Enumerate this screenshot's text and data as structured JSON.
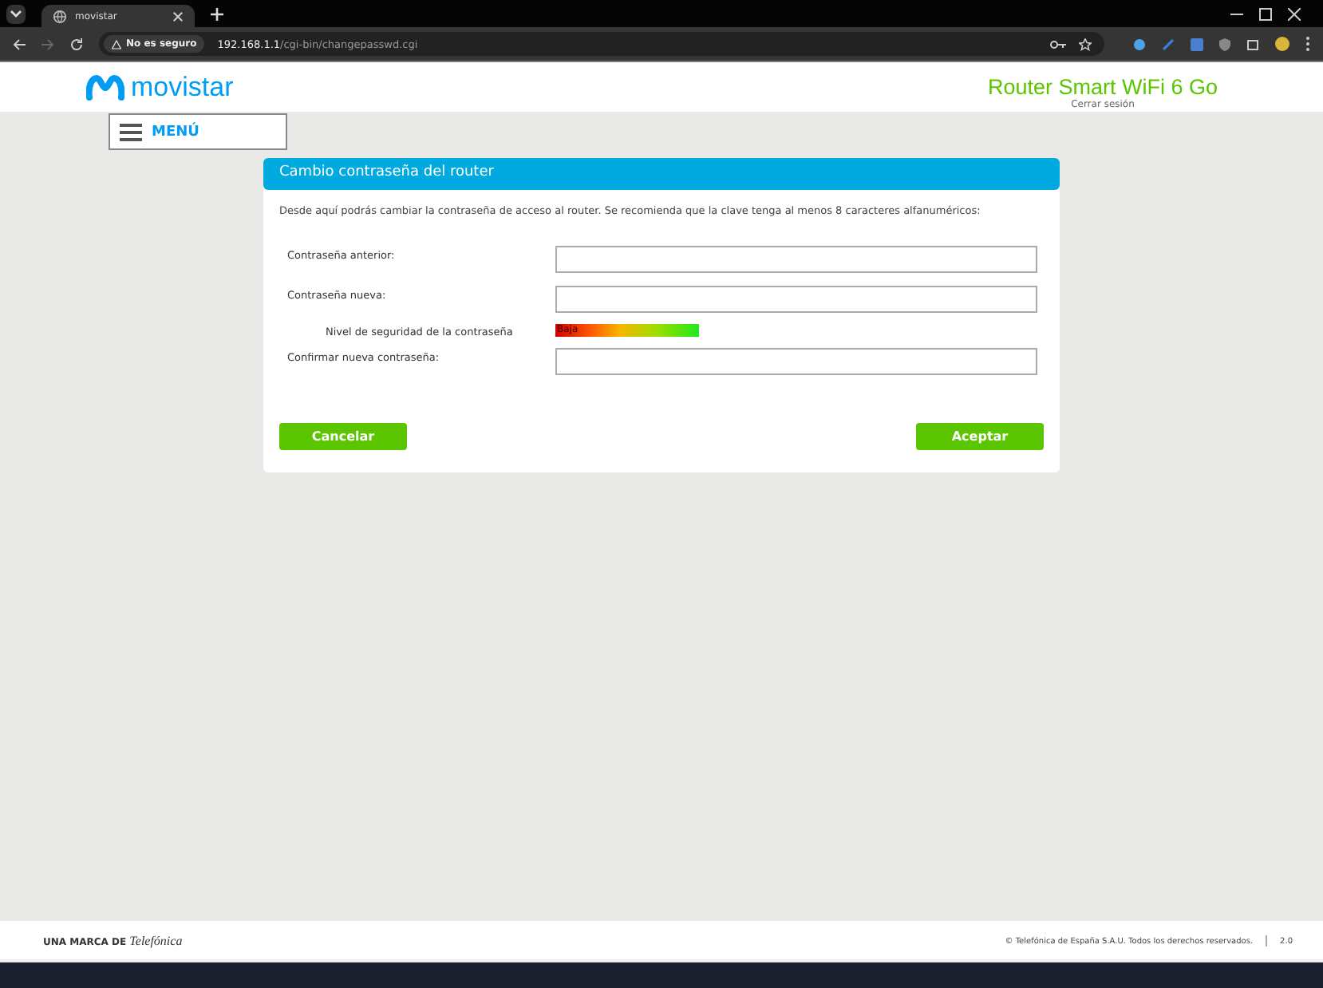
{
  "browser": {
    "tab_title": "movistar",
    "security": "No es seguro",
    "url_host": "192.168.1.1",
    "url_path": "/cgi-bin/changepasswd.cgi"
  },
  "header": {
    "brand": "movistar",
    "product": "Router Smart WiFi 6 Go",
    "logout": "Cerrar sesión",
    "menu": "MENÚ"
  },
  "panel": {
    "title": "Cambio contraseña del router",
    "description": "Desde aquí podrás cambiar la contraseña de acceso al router. Se recomienda que la clave tenga al menos 8 caracteres alfanuméricos:",
    "rows": [
      {
        "kind": "field",
        "label": "Contraseña anterior:"
      },
      {
        "kind": "field",
        "label": "Contraseña nueva:"
      },
      {
        "kind": "meter",
        "label": "Nivel de seguridad de la contraseña",
        "reading": "Baja"
      },
      {
        "kind": "field",
        "label": "Confirmar nueva contraseña:"
      }
    ],
    "buttons": [
      "Cancelar",
      "Aceptar"
    ]
  },
  "footer": {
    "brand_prefix": "UNA MARCA DE",
    "brand": "Telefónica",
    "copyright": "© Telefónica de España S.A.U. Todos los derechos reservados.",
    "version": "2.0"
  }
}
